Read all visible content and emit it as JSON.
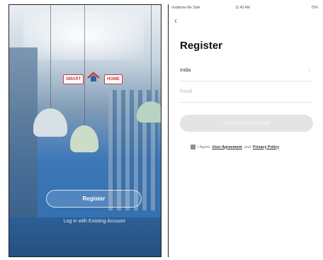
{
  "left": {
    "logo_left": "SMART",
    "logo_right": "HOME",
    "register_label": "Register",
    "login_label": "Log in with Existing Account"
  },
  "right": {
    "status": {
      "carrier": "Vodafone-Be Safe",
      "time": "11:45 AM",
      "battery": "75%"
    },
    "title": "Register",
    "country_value": "India",
    "email_placeholder": "Email",
    "verify_button": "Get Verification Code",
    "agreement": {
      "prefix": "I Agree",
      "user_agreement": "User Agreement",
      "and": "and",
      "privacy_policy": "Privacy Policy"
    }
  },
  "colors": {
    "accent_red": "#c43b3b",
    "blue_background": "#3c77b8",
    "disabled_button": "#e4e4e4"
  },
  "icons": [
    "back-arrow-icon",
    "chevron-right-icon",
    "checkbox-icon",
    "smart-home-logo-icon"
  ]
}
